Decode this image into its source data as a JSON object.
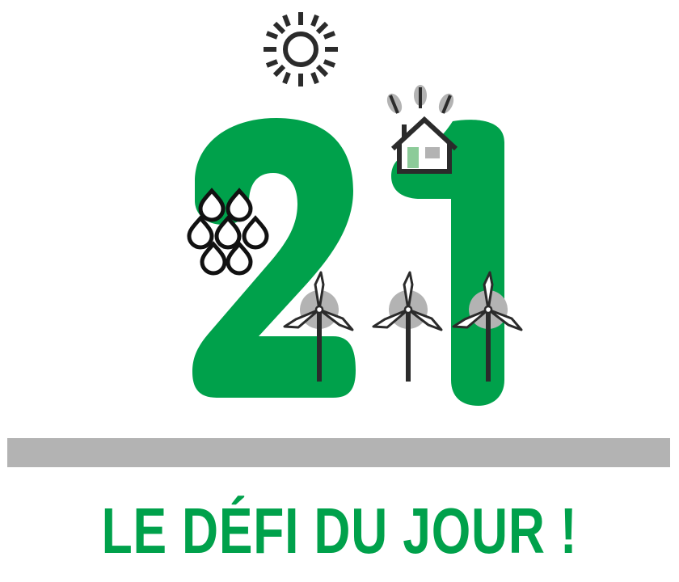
{
  "badge": {
    "number": "21",
    "tagline": "LE DÉFI DU JOUR !"
  },
  "colors": {
    "green": "#00A14B",
    "dark": "#2B2B2B",
    "gray": "#B3B3B3",
    "light_green": "#8CCB99",
    "background": "#FFFFFF"
  },
  "icons": [
    "sun-icon",
    "house-icon",
    "leaf-icon",
    "water-drop-icon",
    "wind-turbine-icon"
  ]
}
